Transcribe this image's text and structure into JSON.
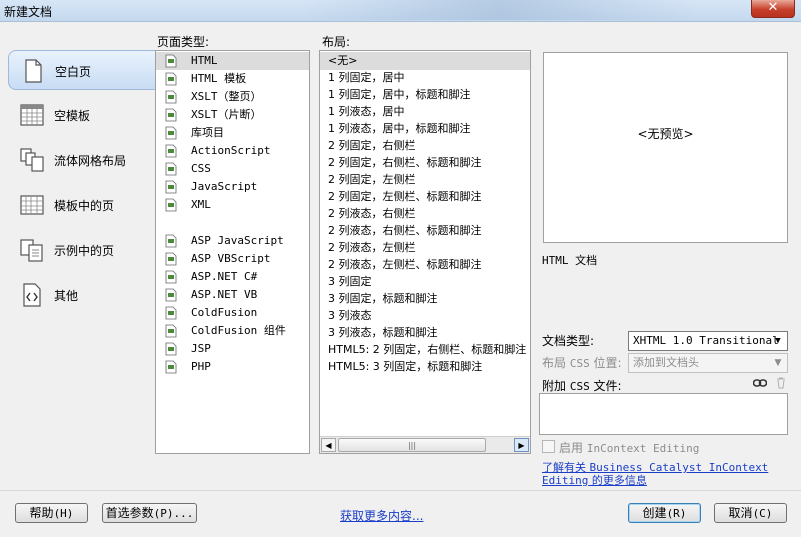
{
  "window": {
    "title": "新建文档",
    "close_glyph": "✕"
  },
  "nav": [
    {
      "label": "空白页",
      "icon": "blank-page-icon"
    },
    {
      "label": "空模板",
      "icon": "blank-template-icon"
    },
    {
      "label": "流体网格布局",
      "icon": "fluid-grid-icon"
    },
    {
      "label": "模板中的页",
      "icon": "template-page-icon"
    },
    {
      "label": "示例中的页",
      "icon": "sample-page-icon"
    },
    {
      "label": "其他",
      "icon": "other-icon"
    }
  ],
  "page_types": {
    "label": "页面类型:",
    "items": [
      "HTML",
      "HTML 模板",
      "XSLT（整页）",
      "XSLT（片断）",
      "库项目",
      "ActionScript",
      "CSS",
      "JavaScript",
      "XML",
      "",
      "ASP JavaScript",
      "ASP VBScript",
      "ASP.NET C#",
      "ASP.NET VB",
      "ColdFusion",
      "ColdFusion 组件",
      "JSP",
      "PHP"
    ],
    "selected": "HTML"
  },
  "layouts": {
    "label": "布局:",
    "items": [
      "<无>",
      "1 列固定，居中",
      "1 列固定，居中，标题和脚注",
      "1 列液态，居中",
      "1 列液态，居中，标题和脚注",
      "2 列固定，右侧栏",
      "2 列固定，右侧栏、标题和脚注",
      "2 列固定，左侧栏",
      "2 列固定，左侧栏、标题和脚注",
      "2 列液态，右侧栏",
      "2 列液态，右侧栏、标题和脚注",
      "2 列液态，左侧栏",
      "2 列液态，左侧栏、标题和脚注",
      "3 列固定",
      "3 列固定，标题和脚注",
      "3 列液态",
      "3 列液态，标题和脚注",
      "HTML5: 2 列固定，右侧栏、标题和脚注",
      "HTML5: 3 列固定，标题和脚注"
    ],
    "selected": "<无>",
    "scroll_thumb_glyph": "|||"
  },
  "preview": {
    "text": "<无预览>",
    "description": "HTML 文档"
  },
  "doc_type": {
    "label": "文档类型:",
    "value": "XHTML 1.0 Transitional"
  },
  "layout_css": {
    "label_a": "布局 ",
    "label_b": "CSS",
    "label_c": " 位置:",
    "value": "添加到文档头"
  },
  "attach_css": {
    "label_a": "附加 ",
    "label_b": "CSS",
    "label_c": " 文件:"
  },
  "incontext": {
    "label_a": "启用 ",
    "label_b": "InContext Editing"
  },
  "bc_link": {
    "a": "了解有关 ",
    "b": "Business Catalyst InContext Editing",
    "c": " 的更多信息"
  },
  "buttons": {
    "help": {
      "a": "帮助",
      "b": "(H)"
    },
    "prefs": {
      "a": "首选参数",
      "b": "(P)..."
    },
    "more": "获取更多内容...",
    "create": {
      "a": "创建",
      "b": "(R)"
    },
    "cancel": {
      "a": "取消",
      "b": "(C)"
    }
  }
}
